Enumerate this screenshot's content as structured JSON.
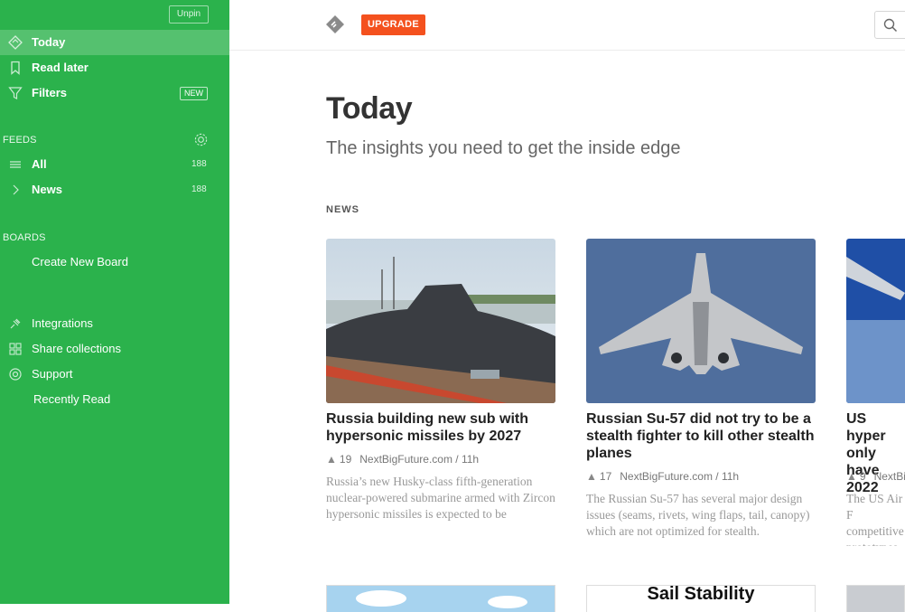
{
  "sidebar": {
    "unpin_label": "Unpin",
    "nav": [
      {
        "label": "Today",
        "icon": "today-icon"
      },
      {
        "label": "Read later",
        "icon": "bookmark-icon"
      },
      {
        "label": "Filters",
        "icon": "filter-icon",
        "badge": "NEW"
      }
    ],
    "feeds_heading": "FEEDS",
    "feeds": [
      {
        "label": "All",
        "count": "188",
        "icon": "list-icon"
      },
      {
        "label": "News",
        "count": "188",
        "icon": "chevron-right-icon"
      }
    ],
    "boards_heading": "BOARDS",
    "create_board": "Create New Board",
    "extras": [
      {
        "label": "Integrations",
        "icon": "plug-icon"
      },
      {
        "label": "Share collections",
        "icon": "grid-icon"
      },
      {
        "label": "Support",
        "icon": "lifebuoy-icon"
      }
    ],
    "recently_read": "Recently Read"
  },
  "topbar": {
    "upgrade_label": "UPGRADE",
    "accent": "#f4511e"
  },
  "main": {
    "title": "Today",
    "subtitle": "The insights you need to get the inside edge",
    "section": "NEWS"
  },
  "cards": [
    {
      "title": "Russia building new sub with hypersonic missiles by 2027",
      "engagement": "19",
      "source": "NextBigFuture.com / 11h",
      "desc": "Russia’s new Husky-class fifth-generation nuclear-powered submarine armed with Zircon hypersonic missiles is expected to be"
    },
    {
      "title": "Russian Su-57 did not try to be a stealth fighter to kill other stealth planes",
      "engagement": "17",
      "source": "NextBigFuture.com / 11h",
      "desc": "The Russian Su-57 has several major design issues (seams, rivets, wing flaps, tail, canopy) which are not optimized for stealth."
    },
    {
      "title": "US hyper only have 2022",
      "engagement": "9",
      "source": "NextBi",
      "desc": "The US Air F competitive prototypes"
    }
  ],
  "bottom_cards": [
    {
      "caption": "Sail Stability"
    }
  ],
  "colors": {
    "sidebar": "#2bb24c"
  }
}
